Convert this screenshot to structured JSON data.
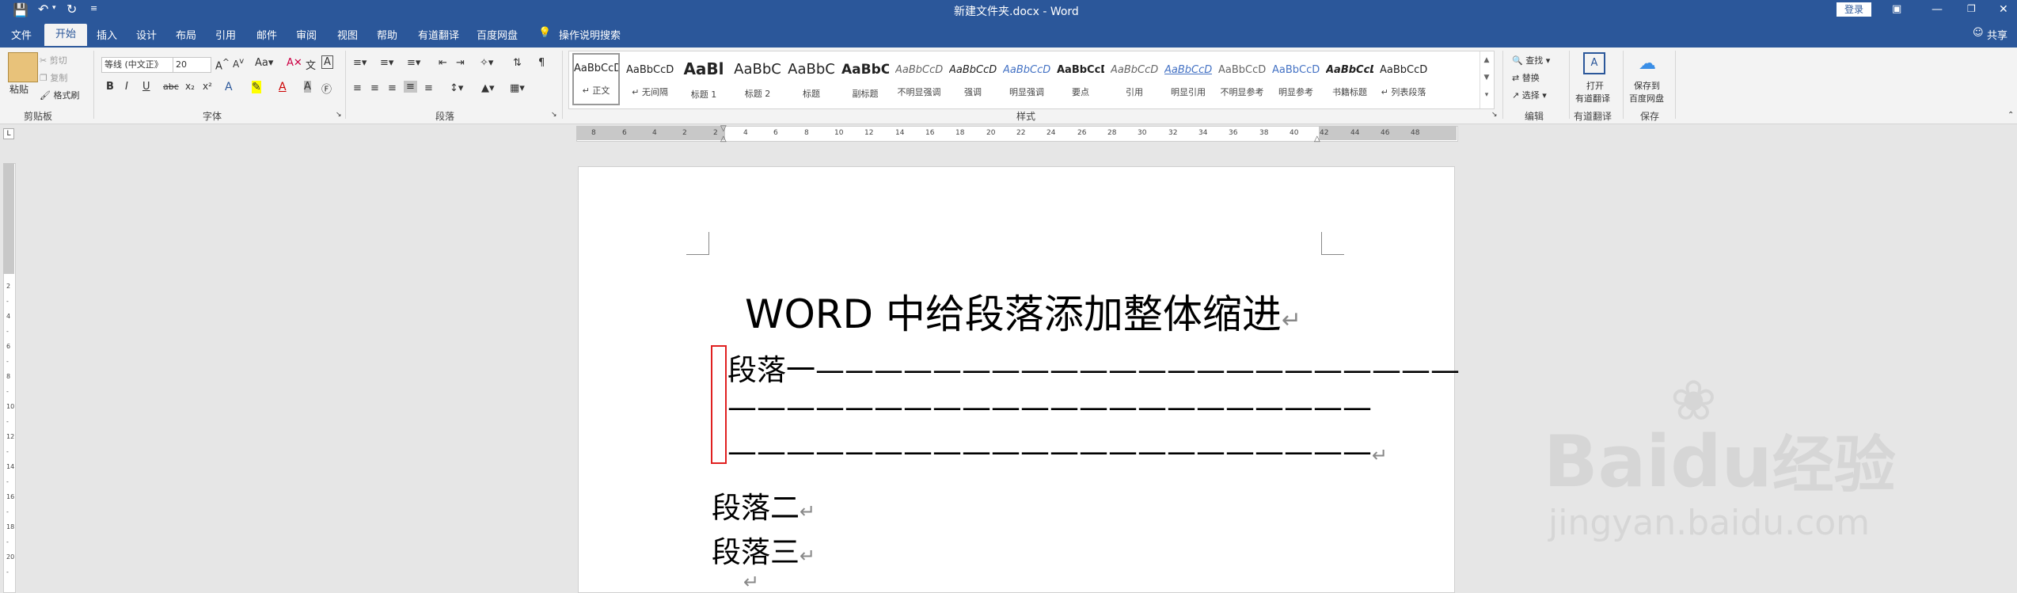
{
  "title_bar": {
    "doc_title": "新建文件夹.docx  -  Word",
    "login": "登录",
    "share": "共享",
    "quick_access": [
      "save-icon",
      "undo-icon",
      "redo-icon",
      "customize-icon"
    ]
  },
  "tabs": [
    "文件",
    "开始",
    "插入",
    "设计",
    "布局",
    "引用",
    "邮件",
    "审阅",
    "视图",
    "帮助",
    "有道翻译",
    "百度网盘"
  ],
  "active_tab": "开始",
  "tell_me": "操作说明搜索",
  "ribbon": {
    "clipboard": {
      "paste": "粘贴",
      "cut": "剪切",
      "copy": "复制",
      "format_painter": "格式刷",
      "label": "剪贴板"
    },
    "font": {
      "font_name": "等线 (中文正》",
      "font_size": "20",
      "label": "字体",
      "buttons": [
        "B",
        "I",
        "U",
        "abc",
        "x₂",
        "x²"
      ]
    },
    "paragraph": {
      "label": "段落"
    },
    "styles": {
      "label": "样式",
      "items": [
        {
          "preview": "AaBbCcDı",
          "name": "↵ 正文"
        },
        {
          "preview": "AaBbCcDı",
          "name": "↵ 无间隔"
        },
        {
          "preview": "AaBl",
          "name": "标题 1"
        },
        {
          "preview": "AaBbC",
          "name": "标题 2"
        },
        {
          "preview": "AaBbC",
          "name": "标题"
        },
        {
          "preview": "AaBbC",
          "name": "副标题"
        },
        {
          "preview": "AaBbCcD",
          "name": "不明显强调"
        },
        {
          "preview": "AaBbCcD",
          "name": "强调"
        },
        {
          "preview": "AaBbCcD",
          "name": "明显强调"
        },
        {
          "preview": "AaBbCcD",
          "name": "要点"
        },
        {
          "preview": "AaBbCcD",
          "name": "引用"
        },
        {
          "preview": "AaBbCcD",
          "name": "明显引用"
        },
        {
          "preview": "AaBbCcDı",
          "name": "不明显参考"
        },
        {
          "preview": "AaBbCcDı",
          "name": "明显参考"
        },
        {
          "preview": "AaBbCcD",
          "name": "书籍标题"
        },
        {
          "preview": "AaBbCcDı",
          "name": "↵ 列表段落"
        }
      ]
    },
    "editing": {
      "find": "查找",
      "replace": "替换",
      "select": "选择",
      "label": "编辑"
    },
    "translate": {
      "open": "打开",
      "open2": "有道翻译",
      "label": "有道翻译"
    },
    "save_cloud": {
      "line1": "保存到",
      "line2": "百度网盘",
      "label": "保存"
    }
  },
  "ruler": {
    "labels": [
      "8",
      "6",
      "4",
      "2",
      "2",
      "4",
      "6",
      "8",
      "10",
      "12",
      "14",
      "16",
      "18",
      "20",
      "22",
      "24",
      "26",
      "28",
      "30",
      "32",
      "34",
      "36",
      "38",
      "40",
      "42",
      "44",
      "46",
      "48"
    ]
  },
  "document": {
    "title": "WORD 中给段落添加整体缩进",
    "para1_line1": "段落一——————————————————————",
    "para1_line2": "——————————————————————",
    "para1_line3": "——————————————————————",
    "para2": "段落二",
    "para3": "段落三",
    "pilcrow": "↵"
  },
  "watermark": {
    "brand": "Bai",
    "brand2": "du",
    "suffix": "经验",
    "url": "jingyan.baidu.com"
  },
  "colors": {
    "titlebar": "#2b579a",
    "highlight": "#e02020"
  }
}
